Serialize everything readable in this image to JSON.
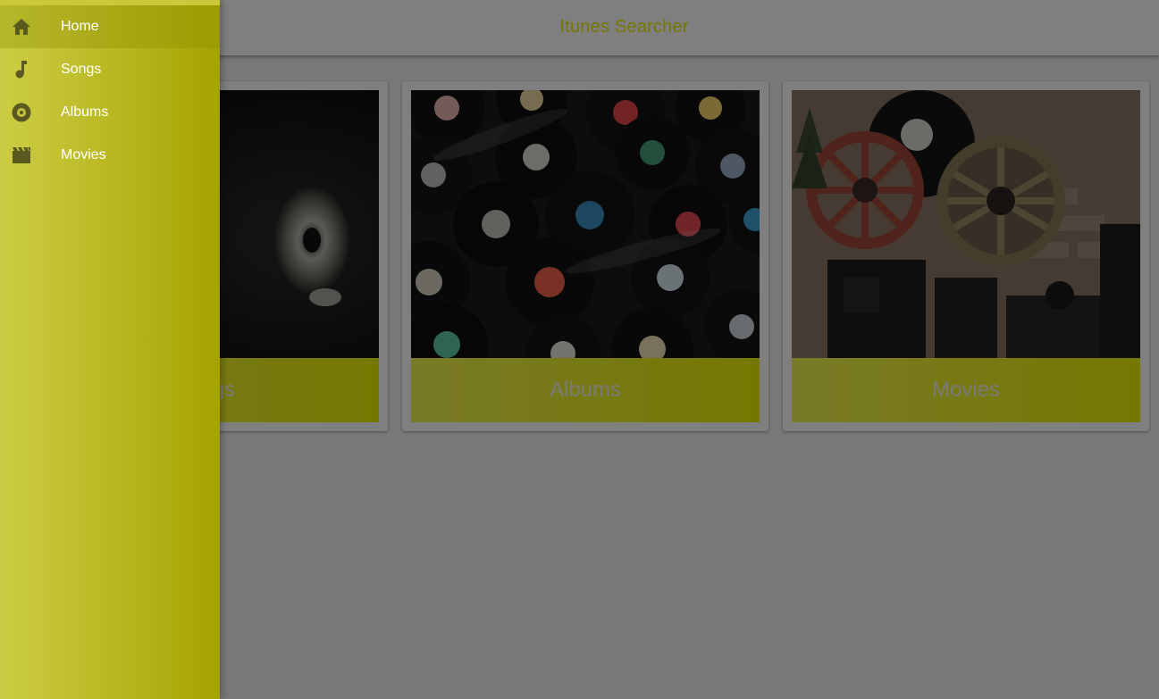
{
  "app": {
    "title": "Itunes Searcher"
  },
  "drawer": {
    "items": [
      {
        "label": "Home",
        "icon": "home-icon",
        "active": true
      },
      {
        "label": "Songs",
        "icon": "music-note-icon",
        "active": false
      },
      {
        "label": "Albums",
        "icon": "album-icon",
        "active": false
      },
      {
        "label": "Movies",
        "icon": "movie-clapper-icon",
        "active": false
      }
    ]
  },
  "cards": [
    {
      "label": "Songs",
      "image": "speaker-photo"
    },
    {
      "label": "Albums",
      "image": "vinyl-records-photo"
    },
    {
      "label": "Movies",
      "image": "film-reels-photo"
    }
  ],
  "colors": {
    "accent": "#eaf000",
    "drawer_gradient_start": "#cdcd45",
    "drawer_gradient_end": "#a5a300",
    "icon": "#5a5a20"
  }
}
